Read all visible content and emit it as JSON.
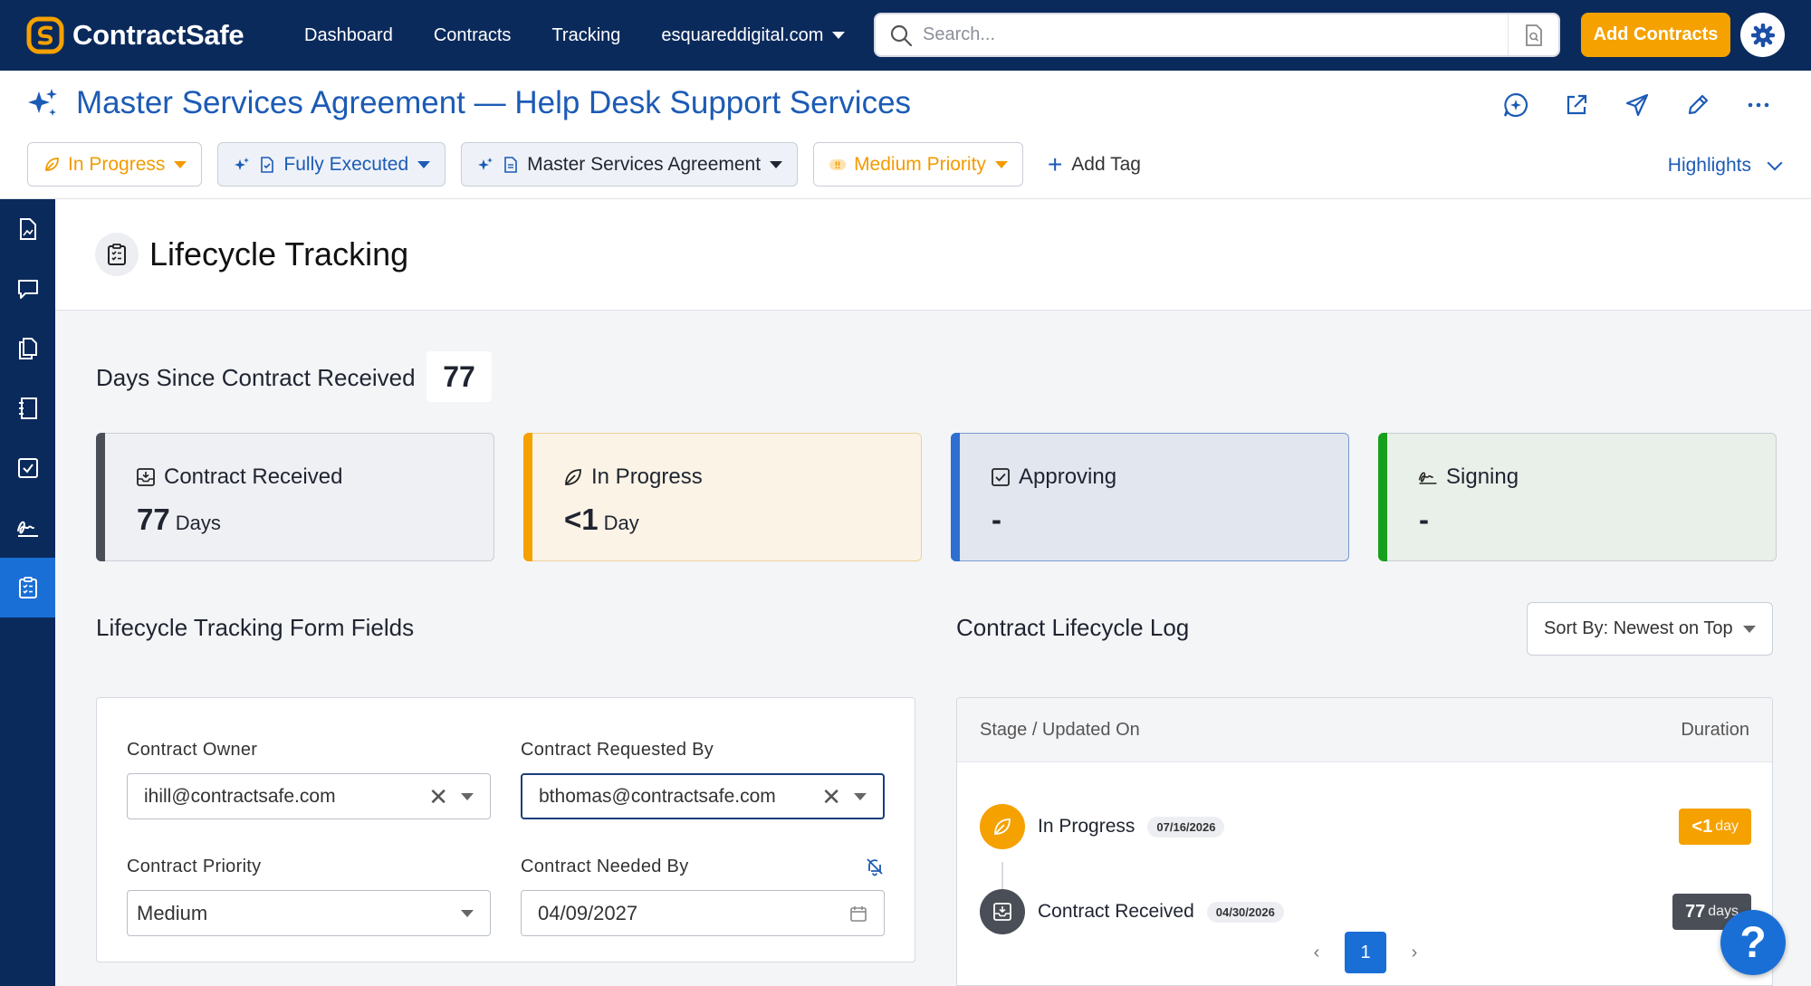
{
  "app": {
    "name": "ContractSafe"
  },
  "nav": {
    "items": [
      "Dashboard",
      "Contracts",
      "Tracking"
    ],
    "domain": "esquareddigital.com"
  },
  "search": {
    "placeholder": "Search..."
  },
  "actions": {
    "add_contracts": "Add Contracts"
  },
  "contract": {
    "title": "Master Services Agreement — Help Desk Support Services",
    "tags": {
      "status": "In Progress",
      "execution": "Fully Executed",
      "type": "Master Services Agreement",
      "priority": "Medium Priority",
      "add_tag": "Add Tag"
    },
    "highlights": "Highlights"
  },
  "section": {
    "title": "Lifecycle Tracking"
  },
  "days_since": {
    "label": "Days Since Contract Received",
    "value": "77"
  },
  "stages": [
    {
      "label": "Contract Received",
      "value": "77",
      "unit": "Days",
      "color": "#4a4f57",
      "bg": "#eef0f3"
    },
    {
      "label": "In Progress",
      "value": "<1",
      "unit": "Day",
      "color": "#f5a100",
      "bg": "#fbf3e6"
    },
    {
      "label": "Approving",
      "value": "-",
      "unit": "",
      "color": "#2f6fd0",
      "bg": "#e1e6ef"
    },
    {
      "label": "Signing",
      "value": "-",
      "unit": "",
      "color": "#17a01d",
      "bg": "#e9f0ea"
    }
  ],
  "form": {
    "title": "Lifecycle Tracking Form Fields",
    "owner_label": "Contract Owner",
    "owner_value": "ihill@contractsafe.com",
    "requested_label": "Contract Requested By",
    "requested_value": "bthomas@contractsafe.com",
    "priority_label": "Contract Priority",
    "priority_value": "Medium",
    "needed_label": "Contract Needed By",
    "needed_value": "04/09/2027"
  },
  "log": {
    "title": "Contract Lifecycle Log",
    "sort": "Sort By: Newest on Top",
    "col_stage": "Stage / Updated On",
    "col_duration": "Duration",
    "rows": [
      {
        "stage": "In Progress",
        "date": "07/16/2026",
        "duration": "<1",
        "unit": "day",
        "color": "#f5a100"
      },
      {
        "stage": "Contract Received",
        "date": "04/30/2026",
        "duration": "77",
        "unit": "days",
        "color": "#4a4f57"
      }
    ],
    "page": "1"
  },
  "help": "?"
}
